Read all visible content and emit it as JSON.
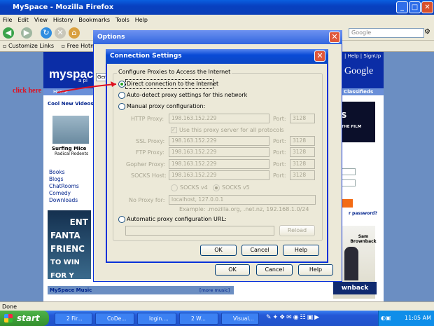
{
  "firefox": {
    "title": "MySpace - Mozilla Firefox",
    "menu": [
      "File",
      "Edit",
      "View",
      "History",
      "Bookmarks",
      "Tools",
      "Help"
    ],
    "search_placeholder": "Google",
    "bookmarks": [
      "Customize Links",
      "Free Hotm"
    ]
  },
  "myspace": {
    "logo": "myspace",
    "logo_sub": "a pl",
    "help_links": "| Help | SignUp",
    "google": "Google",
    "nav_home": "Home",
    "classifieds": "Classifieds",
    "cool_videos": "Cool New Videos",
    "video_title": "Surfing Mice",
    "video_sub": "Radical Rodents",
    "categories": [
      "Books",
      "Blogs",
      "ChatRooms",
      "Comedy",
      "Downloads"
    ],
    "ad_text": [
      "ENT",
      "FANTA",
      "FRIENC",
      "TO WIN",
      "FOR Y"
    ],
    "ad2_text": [
      "ES",
      "M THE FILM"
    ],
    "forgot_password": "r password?",
    "politician": [
      "Sam",
      "Brownback"
    ],
    "brownback_banner": "wnback",
    "music_header": "MySpace Music",
    "more_music": "[more music]"
  },
  "options_dialog": {
    "title": "Options",
    "tab_partial": "Gen",
    "ok": "OK",
    "cancel": "Cancel",
    "help": "Help"
  },
  "connection_settings": {
    "title": "Connection Settings",
    "group_label": "Configure Proxies to Access the Internet",
    "options": {
      "direct": "Direct connection to the Internet",
      "auto_detect": "Auto-detect proxy settings for this network",
      "manual": "Manual proxy configuration:",
      "auto_url": "Automatic proxy configuration URL:"
    },
    "selected": "direct",
    "http_proxy_label": "HTTP Proxy:",
    "http_proxy": "198.163.152.229",
    "http_port": "3128",
    "same_proxy_label": "Use this proxy server for all protocols",
    "ssl_proxy_label": "SSL Proxy:",
    "ssl_proxy": "198.163.152.229",
    "ssl_port": "3128",
    "ftp_proxy_label": "FTP Proxy:",
    "ftp_proxy": "198.163.152.229",
    "ftp_port": "3128",
    "gopher_proxy_label": "Gopher Proxy:",
    "gopher_proxy": "198.163.152.229",
    "gopher_port": "3128",
    "socks_host_label": "SOCKS Host:",
    "socks_host": "198.163.152.229",
    "socks_port": "3128",
    "port_label": "Port:",
    "socks_v4": "SOCKS v4",
    "socks_v5": "SOCKS v5",
    "no_proxy_label": "No Proxy for:",
    "no_proxy": "localhost, 127.0.0.1",
    "example": "Example: .mozilla.org, .net.nz, 192.168.1.0/24",
    "reload": "Reload",
    "ok": "OK",
    "cancel": "Cancel",
    "help": "Help"
  },
  "annotation": "click here",
  "status": "Done",
  "taskbar": {
    "start": "start",
    "tasks": [
      "2 Fir...",
      "CoDe...",
      "login....",
      "2 W...",
      "Visual..."
    ],
    "clock": "11:05 AM"
  },
  "colors": {
    "xp_blue": "#0a4bd6",
    "myspace_blue": "#0b2da6",
    "annotation_red": "#e0101f",
    "start_green": "#328f2c"
  }
}
